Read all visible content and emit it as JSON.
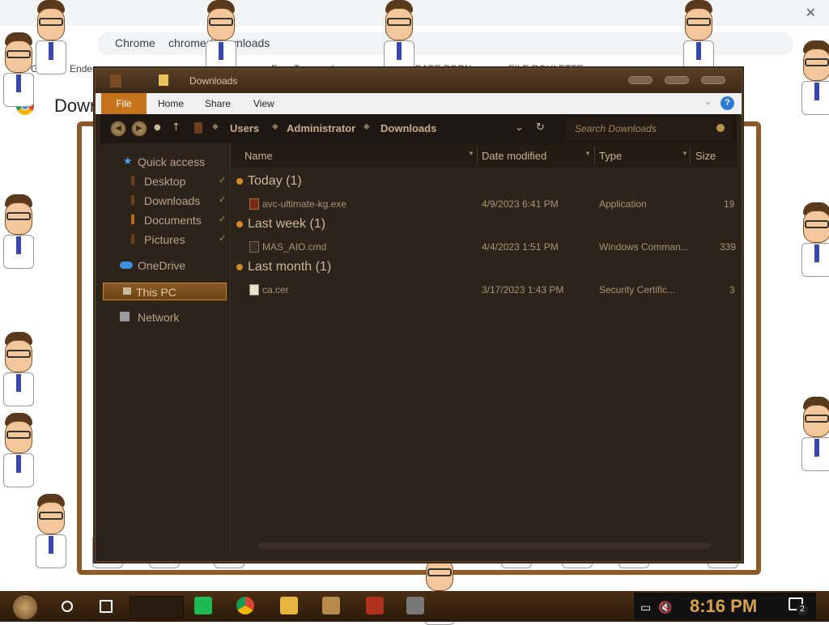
{
  "browser": {
    "address_prefix": "Chrome",
    "address_url": "chrome://downloads",
    "bookmarks": [
      "GitHub - Ender",
      "Free Transcodes",
      "GAY BABE PORN",
      "FILE ROULETTE"
    ],
    "page_title": "Downloads"
  },
  "explorer": {
    "title": "Downloads",
    "ribbon": {
      "file": "File",
      "home": "Home",
      "share": "Share",
      "view": "View"
    },
    "breadcrumb": [
      "Users",
      "Administrator",
      "Downloads"
    ],
    "search_placeholder": "Search Downloads",
    "nav": {
      "quick_access": "Quick access",
      "desktop": "Desktop",
      "downloads": "Downloads",
      "documents": "Documents",
      "pictures": "Pictures",
      "onedrive": "OneDrive",
      "this_pc": "This PC",
      "network": "Network"
    },
    "columns": {
      "name": "Name",
      "date_modified": "Date modified",
      "type": "Type",
      "size": "Size"
    },
    "groups": [
      {
        "label": "Today (1)",
        "files": [
          {
            "name": "avc-ultimate-kg.exe",
            "date": "4/9/2023 6:41 PM",
            "type": "Application",
            "size": "19"
          }
        ]
      },
      {
        "label": "Last week (1)",
        "files": [
          {
            "name": "MAS_AIO.cmd",
            "date": "4/4/2023 1:51 PM",
            "type": "Windows Comman...",
            "size": "339"
          }
        ]
      },
      {
        "label": "Last month (1)",
        "files": [
          {
            "name": "ca.cer",
            "date": "3/17/2023 1:43 PM",
            "type": "Security Certific...",
            "size": "3"
          }
        ]
      }
    ]
  },
  "taskbar": {
    "clock": "8:16 PM",
    "notification_count": "2"
  },
  "colors": {
    "explorer_bg": "#2c231b",
    "accent": "#c5731d",
    "clock": "#d8a24a"
  }
}
